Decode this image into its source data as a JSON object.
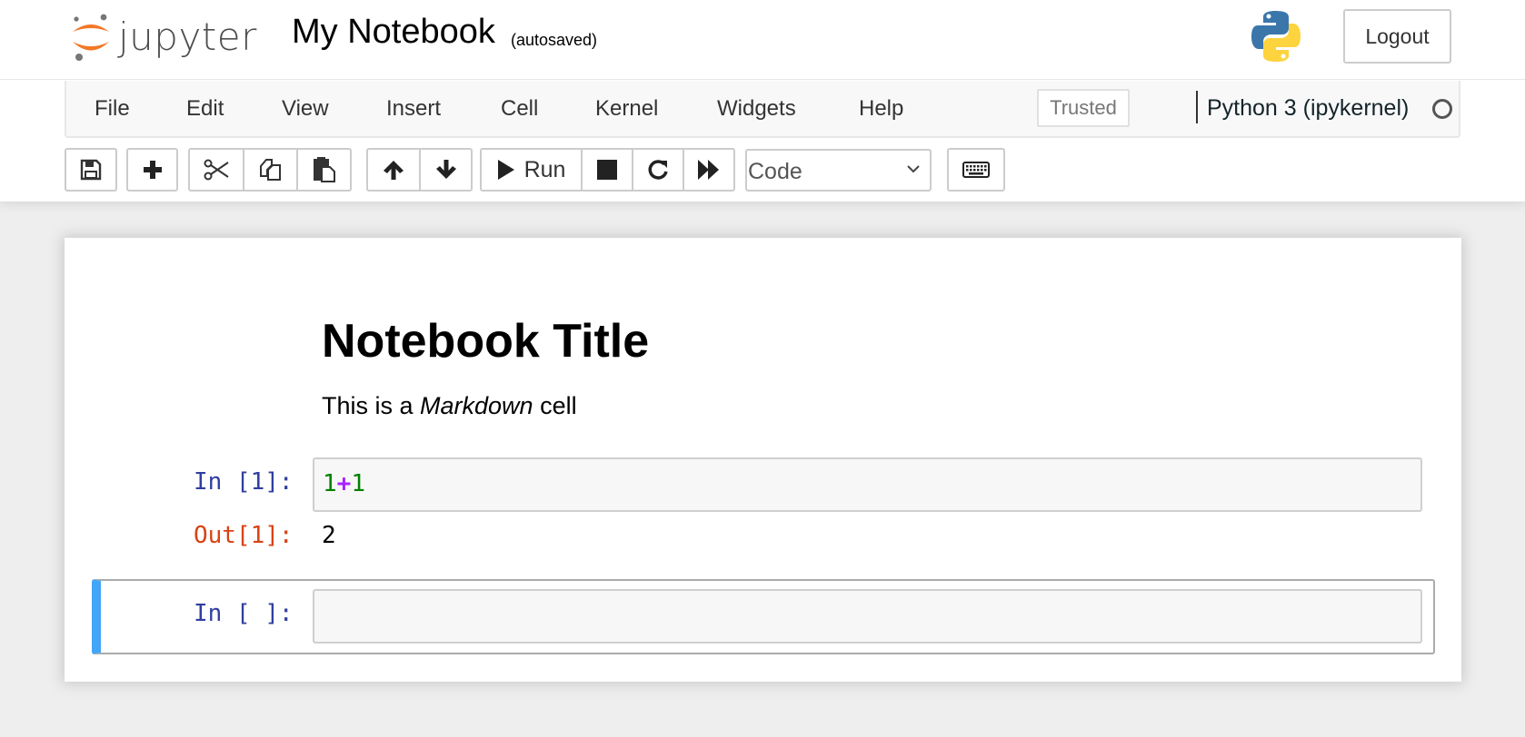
{
  "header": {
    "logo_text": "jupyter",
    "notebook_name": "My Notebook",
    "save_status": "(autosaved)",
    "logout_label": "Logout",
    "brand_colors": {
      "jupyter_orange": "#f37726",
      "jupyter_gray": "#767677",
      "python_blue": "#3a76aa",
      "python_yellow": "#fdd33e"
    }
  },
  "menubar": {
    "items": [
      "File",
      "Edit",
      "View",
      "Insert",
      "Cell",
      "Kernel",
      "Widgets",
      "Help"
    ],
    "trusted_label": "Trusted",
    "kernel_name": "Python 3 (ipykernel)",
    "kernel_status": "idle"
  },
  "toolbar": {
    "buttons": [
      {
        "name": "save",
        "icon": "floppy-disk-icon"
      },
      {
        "name": "insert-cell-below",
        "icon": "plus-icon"
      },
      {
        "name": "cut",
        "icon": "scissors-icon"
      },
      {
        "name": "copy",
        "icon": "copy-icon"
      },
      {
        "name": "paste",
        "icon": "paste-icon"
      },
      {
        "name": "move-up",
        "icon": "arrow-up-icon"
      },
      {
        "name": "move-down",
        "icon": "arrow-down-icon"
      },
      {
        "name": "run",
        "icon": "play-icon"
      },
      {
        "name": "interrupt",
        "icon": "stop-icon"
      },
      {
        "name": "restart",
        "icon": "restart-icon"
      },
      {
        "name": "restart-run-all",
        "icon": "fast-forward-icon"
      },
      {
        "name": "command-palette",
        "icon": "keyboard-icon"
      }
    ],
    "run_label": "Run",
    "cell_type_selected": "Code"
  },
  "notebook": {
    "markdown_cell": {
      "title": "Notebook Title",
      "para_prefix": "This is a ",
      "para_emphasis": "Markdown",
      "para_suffix": " cell"
    },
    "code_cells": [
      {
        "in_prompt": "In [1]:",
        "tokens": [
          {
            "text": "1",
            "type": "number"
          },
          {
            "text": "+",
            "type": "operator"
          },
          {
            "text": "1",
            "type": "number"
          }
        ],
        "out_prompt": "Out[1]:",
        "output": "2"
      },
      {
        "in_prompt": "In [ ]:",
        "source": "",
        "selected": true
      }
    ],
    "selection_color": "#42a5f5",
    "in_prompt_color": "#303f9f",
    "out_prompt_color": "#d84315"
  }
}
